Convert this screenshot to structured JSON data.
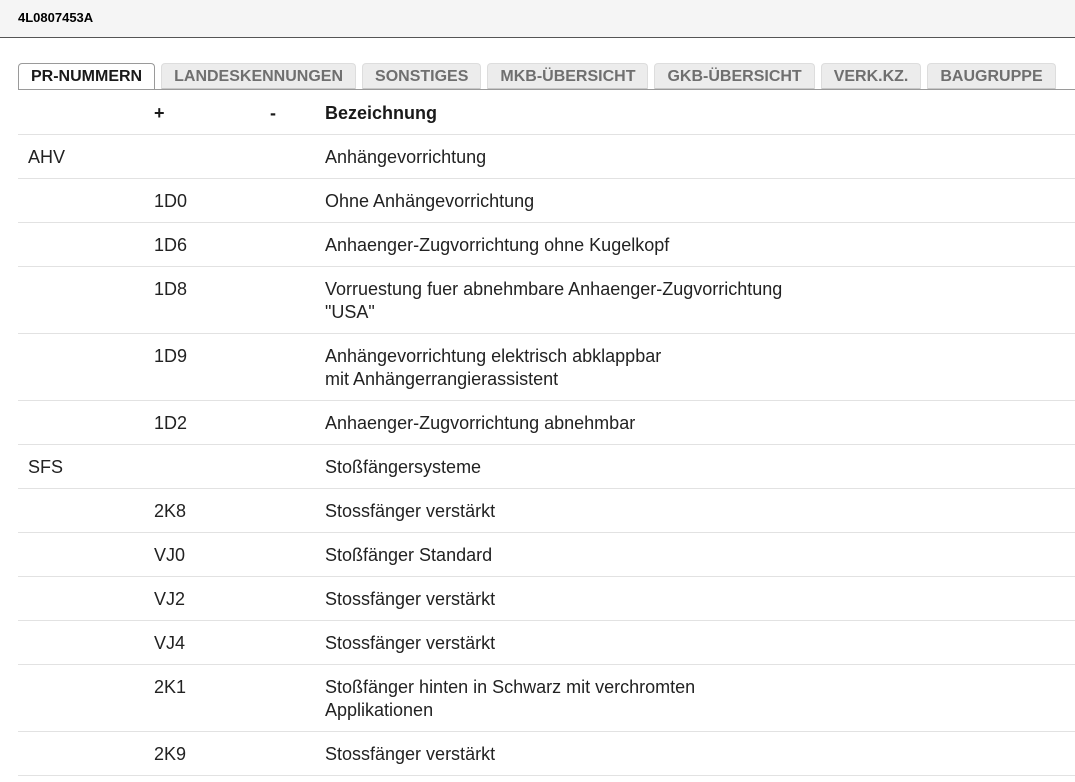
{
  "header": {
    "part_number": "4L0807453A"
  },
  "tabs": [
    {
      "label": "PR-NUMMERN",
      "active": true
    },
    {
      "label": "LANDESKENNUNGEN",
      "active": false
    },
    {
      "label": "SONSTIGES",
      "active": false
    },
    {
      "label": "MKB-ÜBERSICHT",
      "active": false
    },
    {
      "label": "GKB-ÜBERSICHT",
      "active": false
    },
    {
      "label": "VERK.KZ.",
      "active": false
    },
    {
      "label": "BAUGRUPPE",
      "active": false
    }
  ],
  "table": {
    "columns": {
      "code": "",
      "plus": "+",
      "minus": "-",
      "desc": "Bezeichnung"
    },
    "rows": [
      {
        "code": "AHV",
        "plus": "",
        "minus": "",
        "desc": [
          "Anhängevorrichtung"
        ]
      },
      {
        "code": "",
        "plus": "1D0",
        "minus": "",
        "desc": [
          "Ohne Anhängevorrichtung"
        ]
      },
      {
        "code": "",
        "plus": "1D6",
        "minus": "",
        "desc": [
          "Anhaenger-Zugvorrichtung ohne Kugelkopf"
        ]
      },
      {
        "code": "",
        "plus": "1D8",
        "minus": "",
        "desc": [
          "Vorruestung fuer abnehmbare Anhaenger-Zugvorrichtung",
          "\"USA\""
        ]
      },
      {
        "code": "",
        "plus": "1D9",
        "minus": "",
        "desc": [
          "Anhängevorrichtung elektrisch abklappbar",
          "mit Anhängerrangierassistent"
        ]
      },
      {
        "code": "",
        "plus": "1D2",
        "minus": "",
        "desc": [
          "Anhaenger-Zugvorrichtung abnehmbar"
        ]
      },
      {
        "code": "SFS",
        "plus": "",
        "minus": "",
        "desc": [
          "Stoßfängersysteme"
        ]
      },
      {
        "code": "",
        "plus": "2K8",
        "minus": "",
        "desc": [
          "Stossfänger verstärkt"
        ]
      },
      {
        "code": "",
        "plus": "VJ0",
        "minus": "",
        "desc": [
          "Stoßfänger Standard"
        ]
      },
      {
        "code": "",
        "plus": "VJ2",
        "minus": "",
        "desc": [
          "Stossfänger verstärkt"
        ]
      },
      {
        "code": "",
        "plus": "VJ4",
        "minus": "",
        "desc": [
          "Stossfänger verstärkt"
        ]
      },
      {
        "code": "",
        "plus": "2K1",
        "minus": "",
        "desc": [
          "Stoßfänger hinten in Schwarz mit verchromten",
          "Applikationen"
        ]
      },
      {
        "code": "",
        "plus": "2K9",
        "minus": "",
        "desc": [
          "Stossfänger verstärkt"
        ]
      }
    ]
  }
}
